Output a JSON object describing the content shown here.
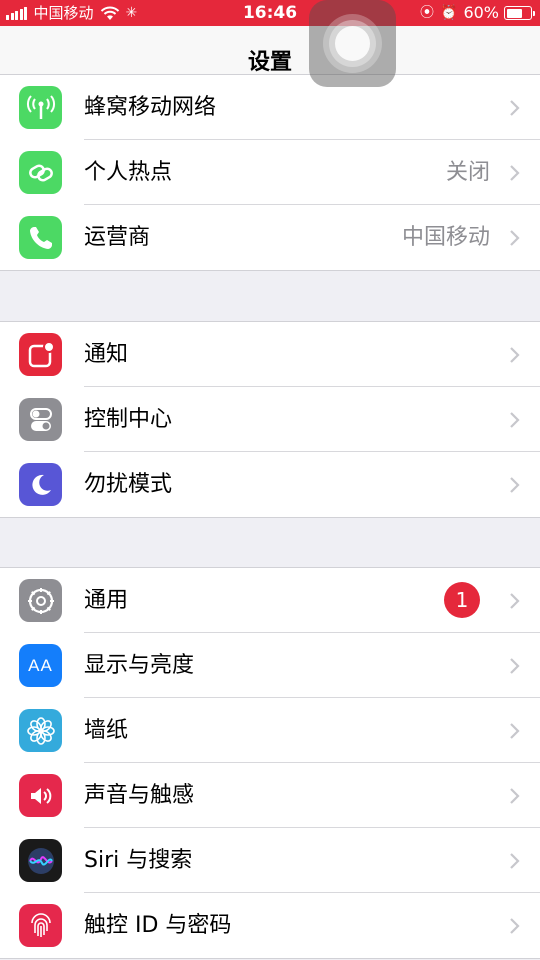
{
  "status_bar": {
    "carrier": "中国移动",
    "time": "16:46",
    "battery_percent": "60%"
  },
  "nav": {
    "title": "设置"
  },
  "groups": [
    {
      "rows": [
        {
          "label": "蜂窝移动网络",
          "icon": "cellular-antenna-icon",
          "color": "#4cd964"
        },
        {
          "label": "个人热点",
          "value": "关闭",
          "icon": "hotspot-link-icon",
          "color": "#4cd964"
        },
        {
          "label": "运营商",
          "value": "中国移动",
          "icon": "phone-icon",
          "color": "#4cd964"
        }
      ]
    },
    {
      "rows": [
        {
          "label": "通知",
          "icon": "notification-icon",
          "color": "#e5283b"
        },
        {
          "label": "控制中心",
          "icon": "toggle-switches-icon",
          "color": "#8e8e93"
        },
        {
          "label": "勿扰模式",
          "icon": "moon-icon",
          "color": "#5856d6"
        }
      ]
    },
    {
      "rows": [
        {
          "label": "通用",
          "badge": "1",
          "icon": "gear-icon",
          "color": "#8e8e93"
        },
        {
          "label": "显示与亮度",
          "icon": "text-size-icon",
          "icon_text": "AA",
          "color": "#147efb"
        },
        {
          "label": "墙纸",
          "icon": "flower-icon",
          "color": "#34aadc"
        },
        {
          "label": "声音与触感",
          "icon": "speaker-icon",
          "color": "#e5284c"
        },
        {
          "label": "Siri 与搜索",
          "icon": "siri-icon",
          "color": "#1a1a1a"
        },
        {
          "label": "触控 ID 与密码",
          "icon": "fingerprint-icon",
          "color": "#e5284c"
        }
      ]
    }
  ]
}
